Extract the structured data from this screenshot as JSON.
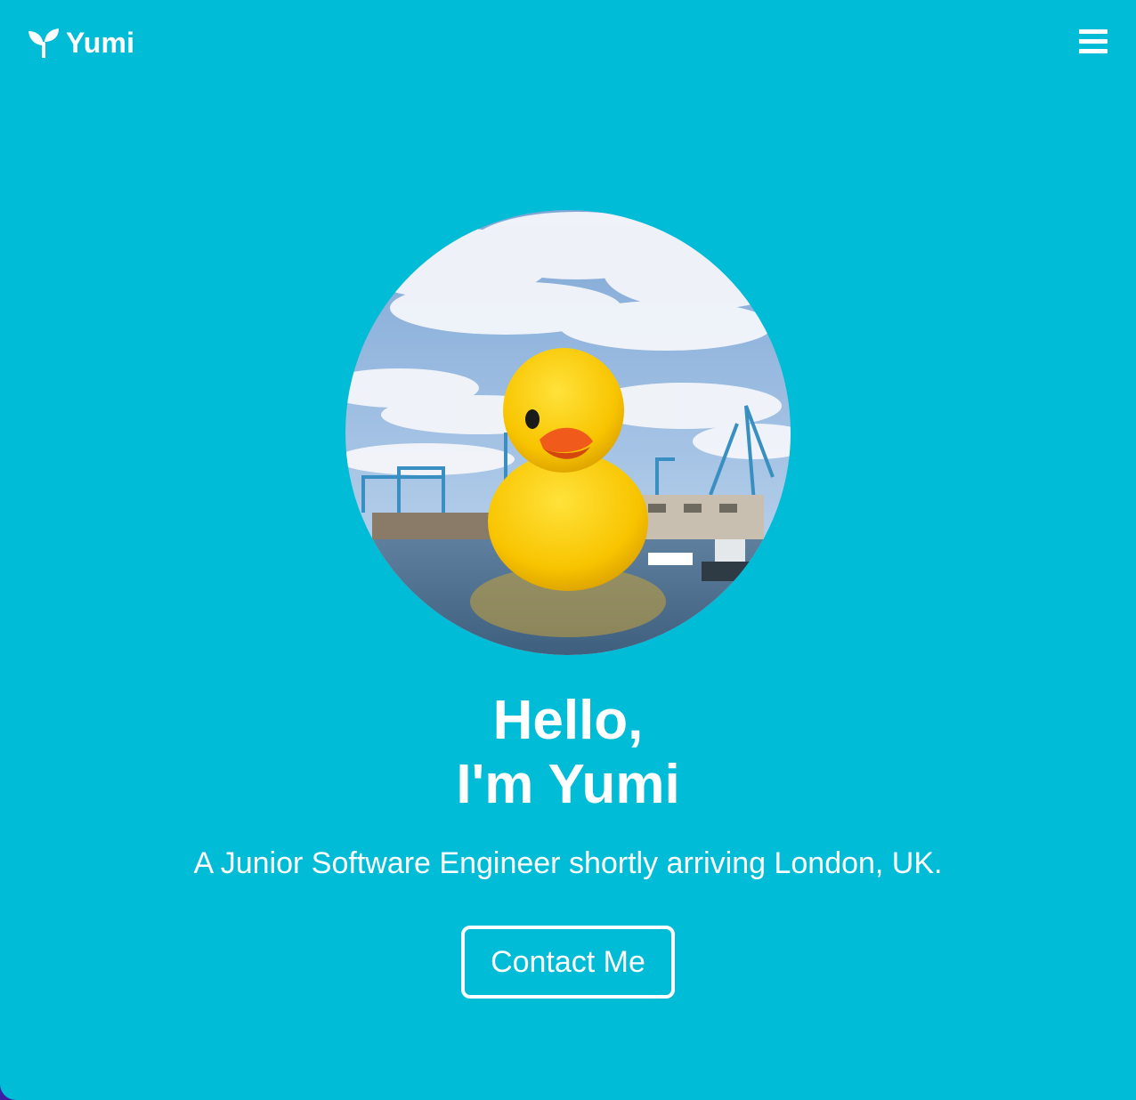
{
  "colors": {
    "page_background": "#00bcd6",
    "text": "#ffffff",
    "outer_background": "#3d1fa3"
  },
  "navbar": {
    "brand_name": "Yumi",
    "brand_icon": "sprout-icon",
    "menu_icon": "hamburger-menu-icon"
  },
  "hero": {
    "avatar_description_icon": "rubber-duck-photo",
    "greeting_line1": "Hello,",
    "greeting_line2": "I'm Yumi",
    "subtitle": "A Junior Software Engineer shortly arriving London, UK.",
    "cta_label": "Contact Me"
  }
}
